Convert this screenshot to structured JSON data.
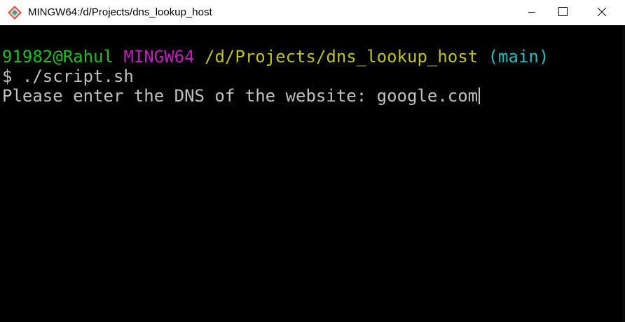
{
  "window": {
    "title": "MINGW64:/d/Projects/dns_lookup_host",
    "icon": "git-bash-icon",
    "controls": {
      "minimize_icon": "minimize-icon",
      "maximize_icon": "maximize-icon",
      "close_icon": "close-icon"
    }
  },
  "terminal": {
    "prompt": {
      "user_host": "91982@Rahul",
      "system": "MINGW64",
      "path": "/d/Projects/dns_lookup_host",
      "branch": "(main)"
    },
    "command_line": "$ ./script.sh",
    "output_prompt": "Please enter the DNS of the website: ",
    "user_input": "google.com"
  },
  "colors": {
    "user": "#1cc21c",
    "system": "#c21cc2",
    "path": "#c2c21c",
    "branch": "#1cc2c2",
    "text": "#c0c0c0",
    "background": "#000000"
  }
}
